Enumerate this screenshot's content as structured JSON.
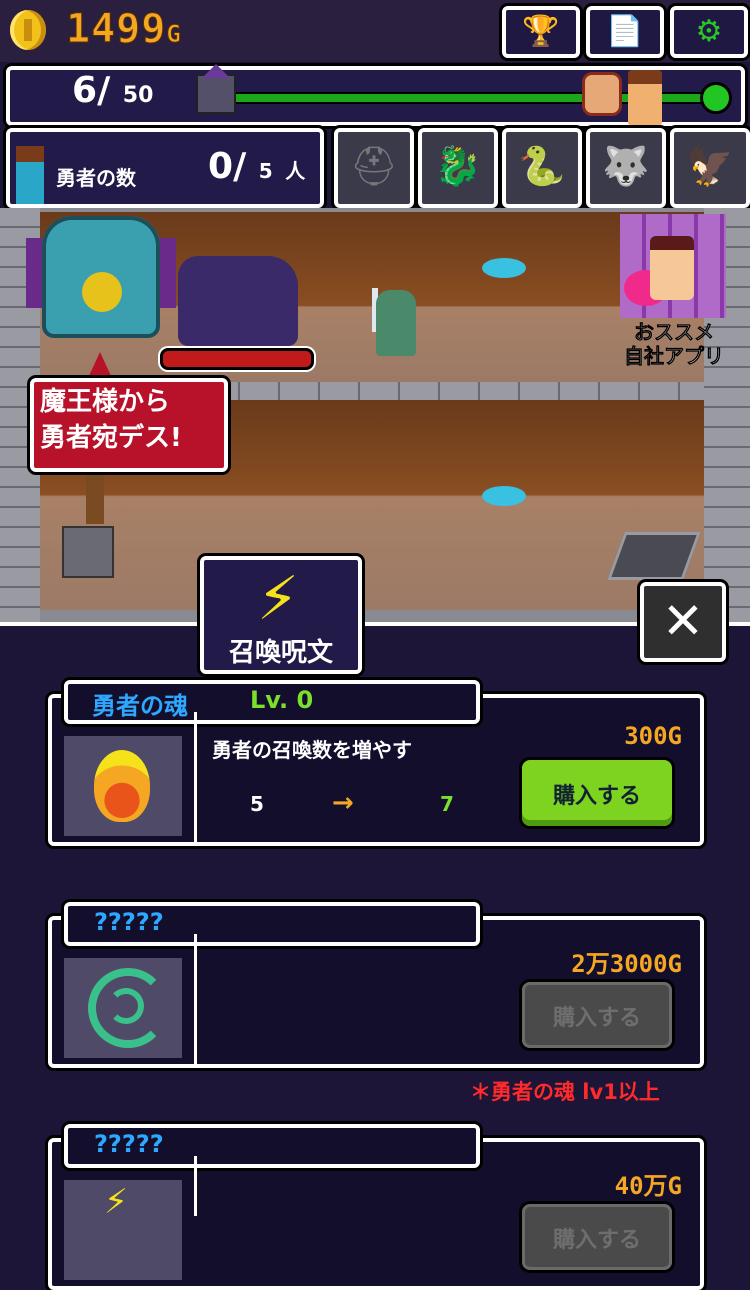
{
  "header": {
    "gold": "1499",
    "gold_unit": "G",
    "buttons": [
      {
        "name": "trophy-icon",
        "glyph": "🏆"
      },
      {
        "name": "document-icon",
        "glyph": "📄"
      },
      {
        "name": "gear-icon",
        "glyph": "⚙"
      }
    ]
  },
  "progress": {
    "current": "6",
    "separator": "/",
    "total": "50"
  },
  "heroes": {
    "label": "勇者の数",
    "current": "0",
    "separator": "/",
    "max": "5",
    "unit": "人"
  },
  "monster_slots": [
    "helmet-icon",
    "dragon-icon",
    "serpent-icon",
    "beast-icon",
    "bird-icon"
  ],
  "scene": {
    "speech": "魔王様から\n勇者宛デス!",
    "ad_label": "おススメ\n自社アプリ",
    "monster_hp_fraction": 1.0
  },
  "panel": {
    "tab_label": "召喚呪文",
    "close_glyph": "✕",
    "cards": [
      {
        "name": "勇者の魂",
        "level": "Lv. 0",
        "price": "300G",
        "description": "勇者の召喚数を増やす",
        "from": "5",
        "arrow": "→",
        "to": "7",
        "buy_label": "購入する",
        "enabled": true
      },
      {
        "name": "?????",
        "level": "",
        "price": "2万3000G",
        "description": "",
        "buy_label": "購入する",
        "enabled": false,
        "requirement": "＊勇者の魂  lv1以上"
      },
      {
        "name": "?????",
        "level": "",
        "price": "40万G",
        "description": "",
        "buy_label": "購入する",
        "enabled": false
      }
    ]
  },
  "colors": {
    "background": "#1c1538",
    "gold": "#f5a623",
    "name_blue": "#2ea8ff",
    "level_green": "#7ae02a",
    "buy_green": "#7ed321",
    "requirement_red": "#ff2a2a"
  }
}
